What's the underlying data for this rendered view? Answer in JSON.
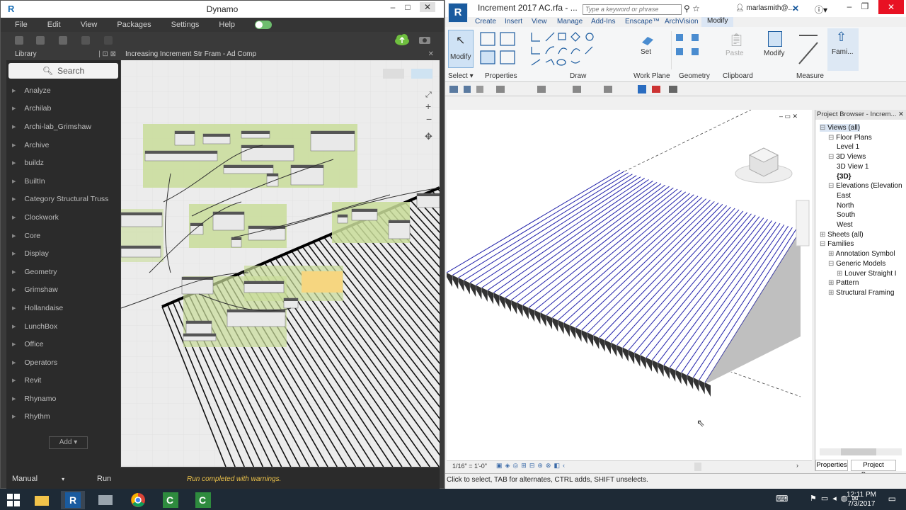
{
  "dynamo": {
    "title": "Dynamo",
    "logo": "R",
    "menu": [
      "File",
      "Edit",
      "View",
      "Packages",
      "Settings",
      "Help"
    ],
    "library_label": "Library",
    "search_placeholder": "Search",
    "library_items": [
      "Analyze",
      "Archilab",
      "Archi-lab_Grimshaw",
      "Archive",
      "buildz",
      "BuiltIn",
      "Category Structural Truss",
      "Clockwork",
      "Core",
      "Display",
      "Geometry",
      "Grimshaw",
      "Hollandaise",
      "LunchBox",
      "Office",
      "Operators",
      "Revit",
      "Rhynamo",
      "Rhythm"
    ],
    "add_label": "Add",
    "tab_label": "Increasing Increment Str Fram - Ad Comp",
    "run_mode": "Manual",
    "run_label": "Run",
    "status": "Run completed with warnings."
  },
  "revit": {
    "logo": "R",
    "doc_title": "Increment 2017 AC.rfa - ...",
    "keyword_placeholder": "Type a keyword or phrase",
    "user": "marlasmith@...",
    "tabs": [
      "Create",
      "Insert",
      "View",
      "Manage",
      "Add-Ins",
      "Enscape™",
      "ArchVision",
      "Modify"
    ],
    "active_tab": "Modify",
    "ribbon_groups": [
      "Select",
      "Properties",
      "Draw",
      "Work Plane",
      "Geometry",
      "Clipboard",
      "Measure"
    ],
    "ribbon_buttons": {
      "modify": "Modify",
      "set": "Set",
      "paste": "Paste",
      "modify2": "Modify",
      "family": "Fami..."
    },
    "scale": "1/16\" = 1'-0\"",
    "status": "Click to select, TAB for alternates, CTRL adds, SHIFT unselects.",
    "browser": {
      "title": "Project Browser - Increm...",
      "views_all": "Views (all)",
      "floor_plans": "Floor Plans",
      "level1": "Level 1",
      "views3d": "3D Views",
      "view3d1": "3D View 1",
      "view3d": "{3D}",
      "elevations": "Elevations (Elevation",
      "east": "East",
      "north": "North",
      "south": "South",
      "west": "West",
      "sheets": "Sheets (all)",
      "families": "Families",
      "annotation": "Annotation Symbol",
      "generic": "Generic Models",
      "louver": "Louver Straight I",
      "pattern": "Pattern",
      "structural": "Structural Framing",
      "tab_properties": "Properties",
      "tab_browser": "Project Brows..."
    }
  },
  "clock": {
    "time": "12:11 PM",
    "date": "7/3/2017"
  }
}
